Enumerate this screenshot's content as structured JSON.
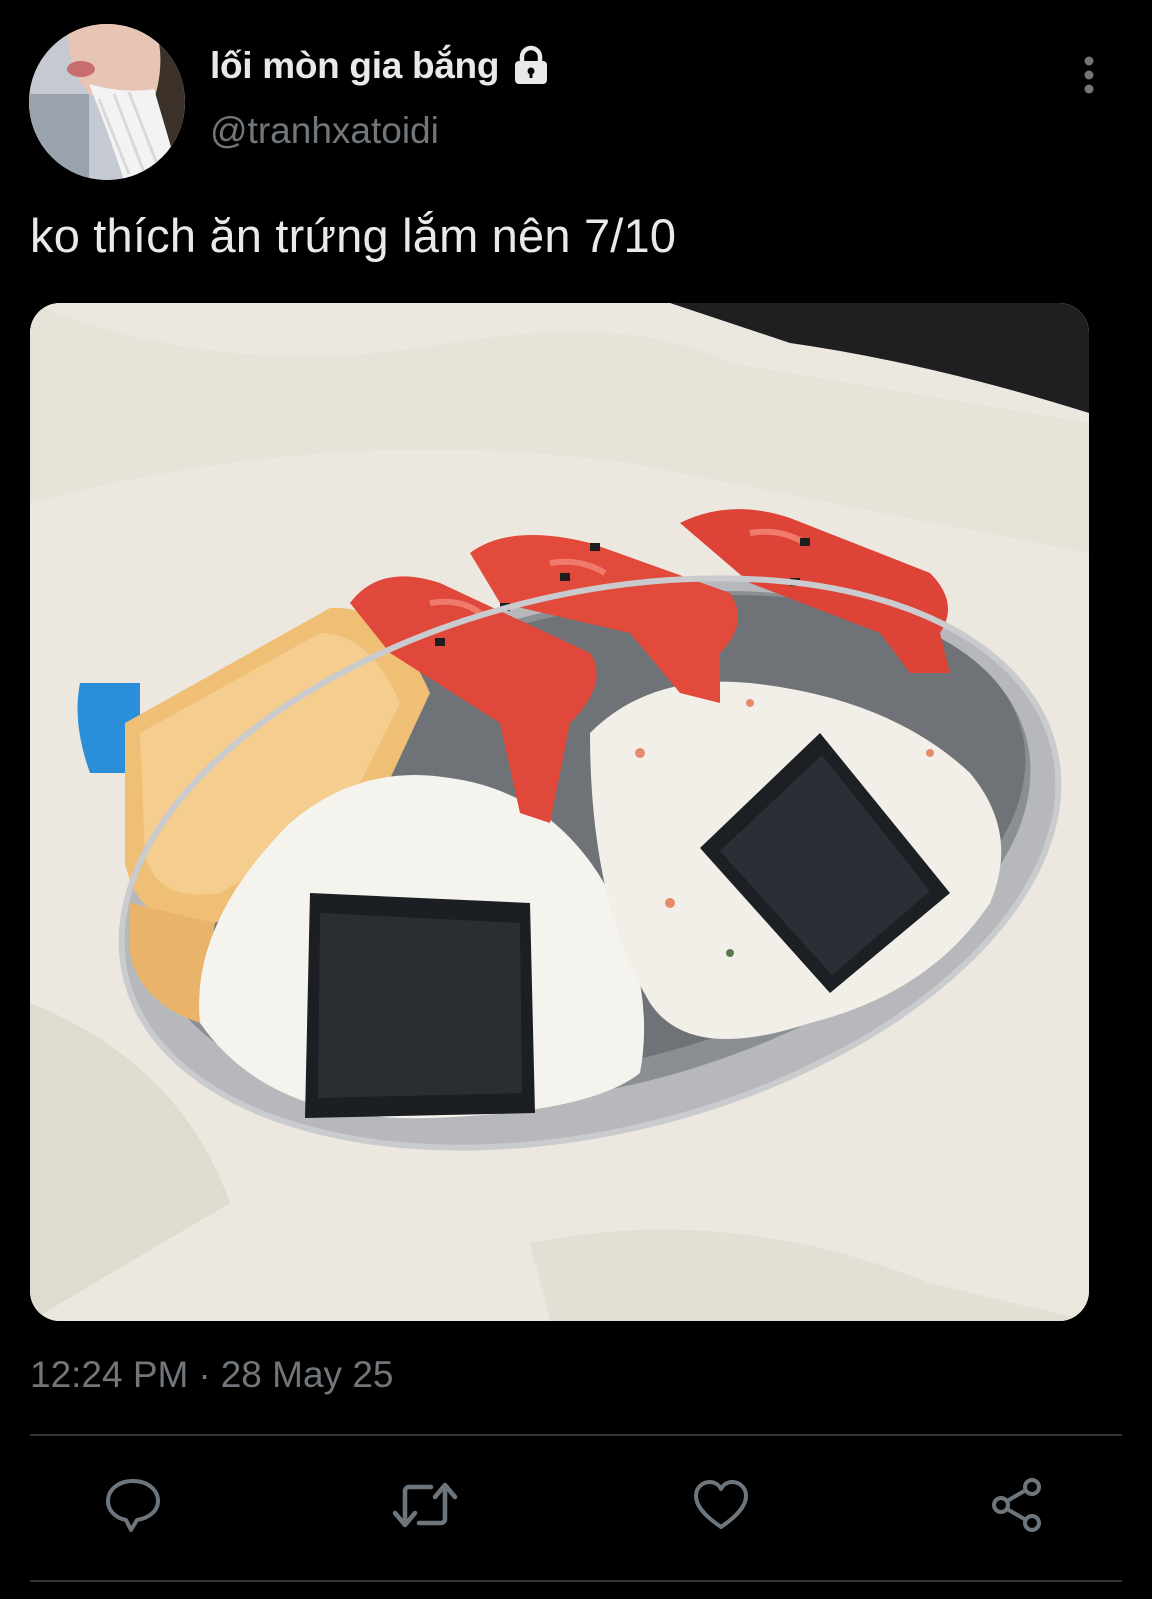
{
  "tweet": {
    "display_name": "lối mòn gia bắng",
    "handle": "@tranhxatoidi",
    "protected_icon": "lock-icon",
    "text": "ko thích ăn trứng lắm nên 7/10",
    "time": "12:24 PM",
    "separator": "·",
    "date": "28 May 25"
  },
  "actions": [
    {
      "icon": "reply-icon"
    },
    {
      "icon": "retweet-icon"
    },
    {
      "icon": "like-icon"
    },
    {
      "icon": "share-icon"
    }
  ],
  "colors": {
    "background": "#000000",
    "primary_text": "#e7e9ea",
    "secondary_text": "#71767b",
    "divider": "#2f3336",
    "action_icon": "#6e767d"
  }
}
